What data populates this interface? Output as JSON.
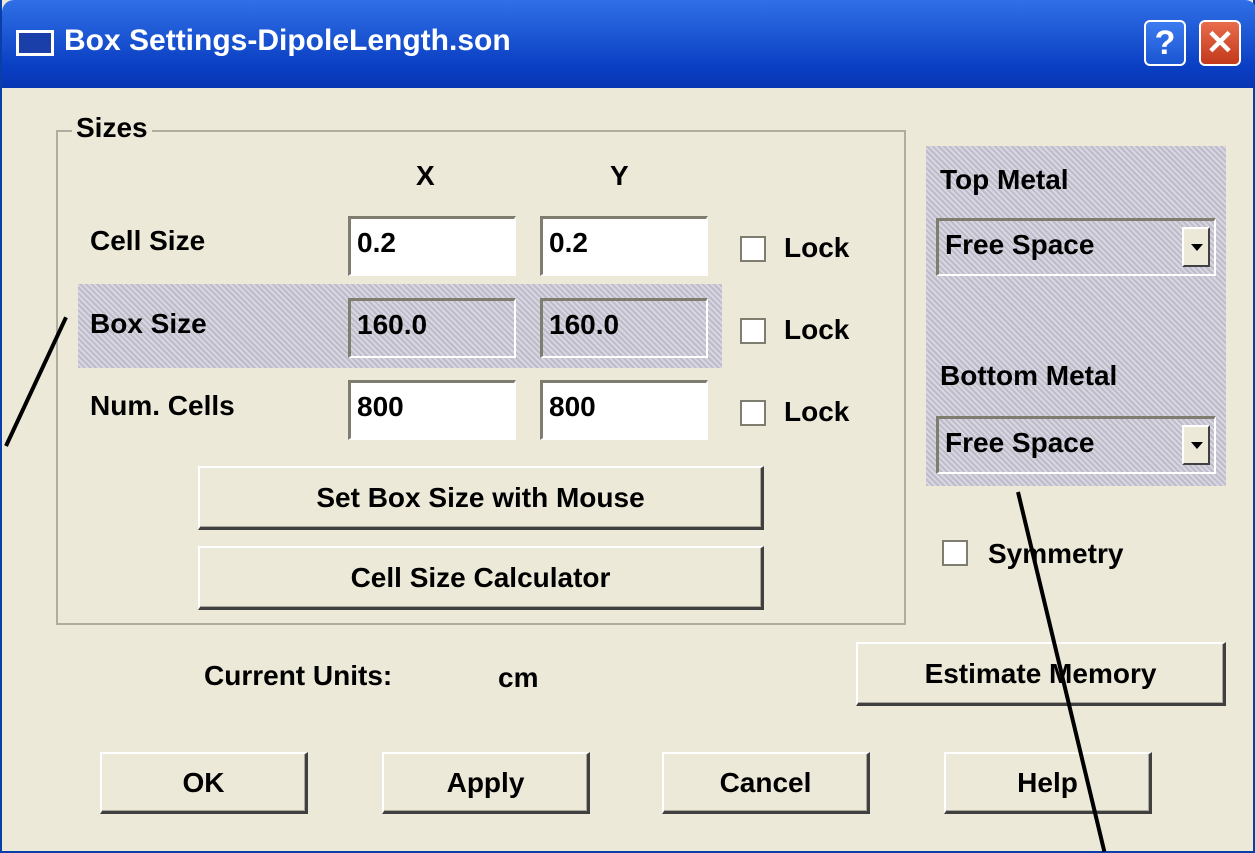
{
  "window": {
    "title": "Box Settings-DipoleLength.son",
    "help_button": "?",
    "close_button": "✕"
  },
  "sizes": {
    "group_title": "Sizes",
    "col_x": "X",
    "col_y": "Y",
    "cell_size": {
      "label": "Cell Size",
      "x": "0.2",
      "y": "0.2",
      "lock_label": "Lock",
      "lock_checked": false
    },
    "box_size": {
      "label": "Box Size",
      "x": "160.0",
      "y": "160.0",
      "lock_label": "Lock",
      "lock_checked": false
    },
    "num_cells": {
      "label": "Num. Cells",
      "x": "800",
      "y": "800",
      "lock_label": "Lock",
      "lock_checked": false
    },
    "set_box_button": "Set Box Size with Mouse",
    "calculator_button": "Cell Size Calculator"
  },
  "metals": {
    "top_label": "Top Metal",
    "top_value": "Free Space",
    "bottom_label": "Bottom Metal",
    "bottom_value": "Free Space"
  },
  "symmetry": {
    "label": "Symmetry",
    "checked": false
  },
  "units": {
    "label": "Current Units:",
    "value": "cm"
  },
  "buttons": {
    "estimate_memory": "Estimate Memory",
    "ok": "OK",
    "apply": "Apply",
    "cancel": "Cancel",
    "help": "Help"
  },
  "colors": {
    "titlebar": "#0a3fc4",
    "dialog_bg": "#ece9d8",
    "close_button": "#c2391b"
  }
}
